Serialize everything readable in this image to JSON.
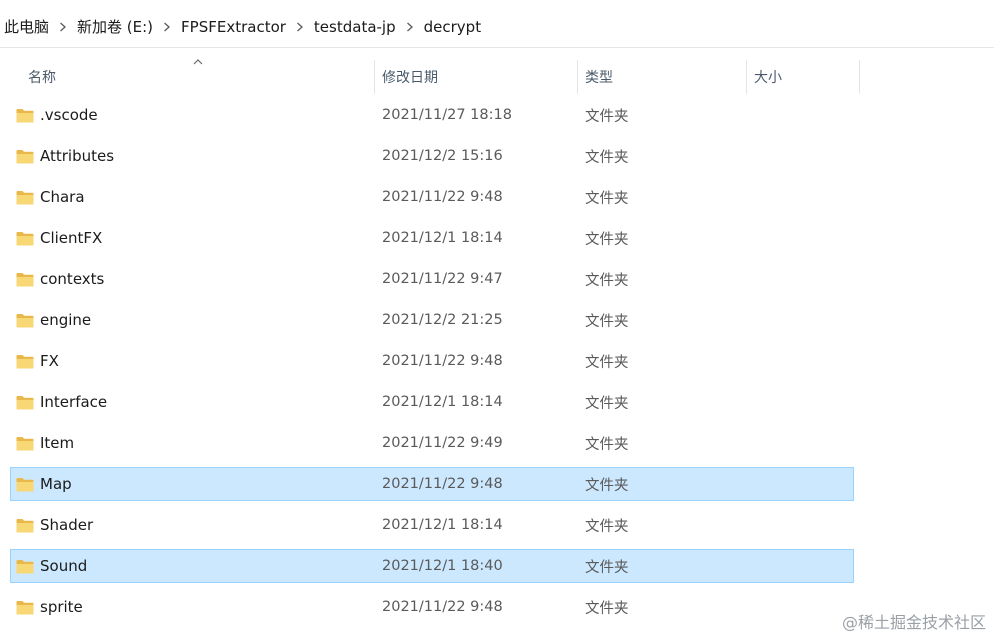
{
  "breadcrumb": {
    "items": [
      "此电脑",
      "新加卷 (E:)",
      "FPSFExtractor",
      "testdata-jp",
      "decrypt"
    ]
  },
  "columns": {
    "name": "名称",
    "modified": "修改日期",
    "type": "类型",
    "size": "大小"
  },
  "colors": {
    "selection_bg": "#cce8ff",
    "selection_border": "#99d1ff",
    "folder_yellow": "#f8d775",
    "folder_dark": "#e8b84a"
  },
  "rows": [
    {
      "name": ".vscode",
      "modified": "2021/11/27 18:18",
      "type": "文件夹",
      "selected": false
    },
    {
      "name": "Attributes",
      "modified": "2021/12/2 15:16",
      "type": "文件夹",
      "selected": false
    },
    {
      "name": "Chara",
      "modified": "2021/11/22 9:48",
      "type": "文件夹",
      "selected": false
    },
    {
      "name": "ClientFX",
      "modified": "2021/12/1 18:14",
      "type": "文件夹",
      "selected": false
    },
    {
      "name": "contexts",
      "modified": "2021/11/22 9:47",
      "type": "文件夹",
      "selected": false
    },
    {
      "name": "engine",
      "modified": "2021/12/2 21:25",
      "type": "文件夹",
      "selected": false
    },
    {
      "name": "FX",
      "modified": "2021/11/22 9:48",
      "type": "文件夹",
      "selected": false
    },
    {
      "name": "Interface",
      "modified": "2021/12/1 18:14",
      "type": "文件夹",
      "selected": false
    },
    {
      "name": "Item",
      "modified": "2021/11/22 9:49",
      "type": "文件夹",
      "selected": false
    },
    {
      "name": "Map",
      "modified": "2021/11/22 9:48",
      "type": "文件夹",
      "selected": true
    },
    {
      "name": "Shader",
      "modified": "2021/12/1 18:14",
      "type": "文件夹",
      "selected": false
    },
    {
      "name": "Sound",
      "modified": "2021/12/1 18:40",
      "type": "文件夹",
      "selected": true
    },
    {
      "name": "sprite",
      "modified": "2021/11/22 9:48",
      "type": "文件夹",
      "selected": false
    }
  ],
  "watermark": "@稀土掘金技术社区"
}
